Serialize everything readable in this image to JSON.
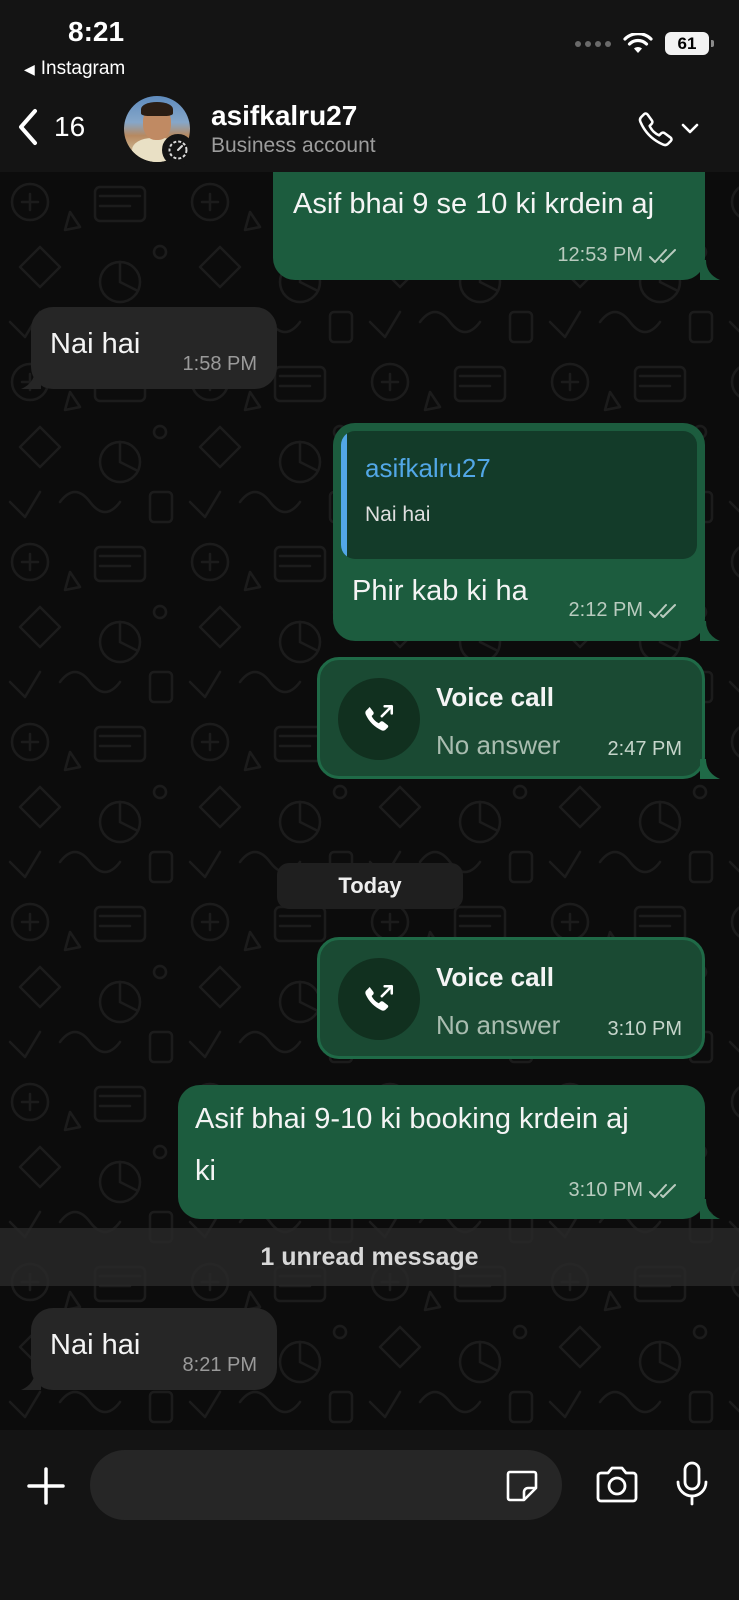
{
  "status_bar": {
    "time": "8:21",
    "back_app": "Instagram",
    "battery": "61"
  },
  "header": {
    "back_count": "16",
    "contact_name": "asifkalru27",
    "contact_sub": "Business account"
  },
  "messages": [
    {
      "direction": "out",
      "text": "Asif bhai 9 se 10 ki krdein aj",
      "time": "12:53 PM",
      "read": true
    },
    {
      "direction": "in",
      "text": "Nai hai",
      "time": "1:58 PM"
    },
    {
      "direction": "out",
      "quote_author": "asifkalru27",
      "quote_text": "Nai hai",
      "text": "Phir kab ki ha",
      "time": "2:12 PM",
      "read": true
    },
    {
      "direction": "out",
      "type": "call",
      "title": "Voice call",
      "status": "No answer",
      "time": "2:47 PM"
    },
    {
      "type": "date",
      "label": "Today"
    },
    {
      "direction": "out",
      "type": "call",
      "title": "Voice call",
      "status": "No answer",
      "time": "3:10 PM"
    },
    {
      "direction": "out",
      "text_line1": "Asif bhai 9-10 ki booking krdein aj",
      "text_line2": "ki",
      "time": "3:10 PM",
      "read": true
    },
    {
      "type": "unread_divider",
      "label": "1 unread message"
    },
    {
      "direction": "in",
      "text": "Nai hai",
      "time": "8:21 PM"
    }
  ],
  "composer": {
    "placeholder": ""
  },
  "colors": {
    "outgoing_bubble": "#1c5c3e",
    "incoming_bubble": "#262626",
    "quote_accent": "#52a7e6",
    "background": "#0c0c0c"
  },
  "icons": [
    "back-chevron-icon",
    "phone-icon",
    "chevron-down-icon",
    "check-double-icon",
    "outgoing-call-icon",
    "plus-icon",
    "sticker-icon",
    "camera-icon",
    "mic-icon",
    "wifi-icon"
  ]
}
